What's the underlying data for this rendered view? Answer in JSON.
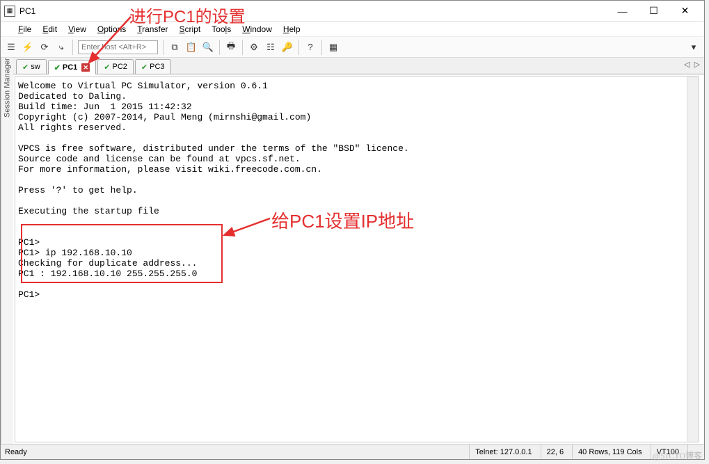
{
  "window": {
    "title": "PC1"
  },
  "win_controls": {
    "min": "—",
    "max": "☐",
    "close": "✕"
  },
  "menu": {
    "file": "File",
    "edit": "Edit",
    "view": "View",
    "options": "Options",
    "transfer": "Transfer",
    "script": "Script",
    "tools": "Tools",
    "window": "Window",
    "help": "Help"
  },
  "toolbar": {
    "host_placeholder": "Enter host <Alt+R>",
    "dropdown_glyph": "▾"
  },
  "side_tab": {
    "label": "Session Manager"
  },
  "tabs": [
    {
      "label": "sw",
      "active": false,
      "closable": false
    },
    {
      "label": "PC1",
      "active": true,
      "closable": true
    },
    {
      "label": "PC2",
      "active": false,
      "closable": false
    },
    {
      "label": "PC3",
      "active": false,
      "closable": false
    }
  ],
  "tab_nav": {
    "left": "◁",
    "right": "▷"
  },
  "terminal": {
    "lines": [
      "Welcome to Virtual PC Simulator, version 0.6.1",
      "Dedicated to Daling.",
      "Build time: Jun  1 2015 11:42:32",
      "Copyright (c) 2007-2014, Paul Meng (mirnshi@gmail.com)",
      "All rights reserved.",
      "",
      "VPCS is free software, distributed under the terms of the \"BSD\" licence.",
      "Source code and license can be found at vpcs.sf.net.",
      "For more information, please visit wiki.freecode.com.cn.",
      "",
      "Press '?' to get help.",
      "",
      "Executing the startup file",
      "",
      "",
      "PC1>",
      "PC1> ip 192.168.10.10",
      "Checking for duplicate address...",
      "PC1 : 192.168.10.10 255.255.255.0",
      "",
      "PC1>"
    ]
  },
  "status": {
    "ready": "Ready",
    "telnet": "Telnet: 127.0.0.1",
    "cursor": "22,   6",
    "size": "40 Rows, 119 Cols",
    "emu": "VT100"
  },
  "annotations": {
    "top": "进行PC1的设置",
    "right": "给PC1设置IP地址"
  },
  "watermark": "@51CTO博客"
}
